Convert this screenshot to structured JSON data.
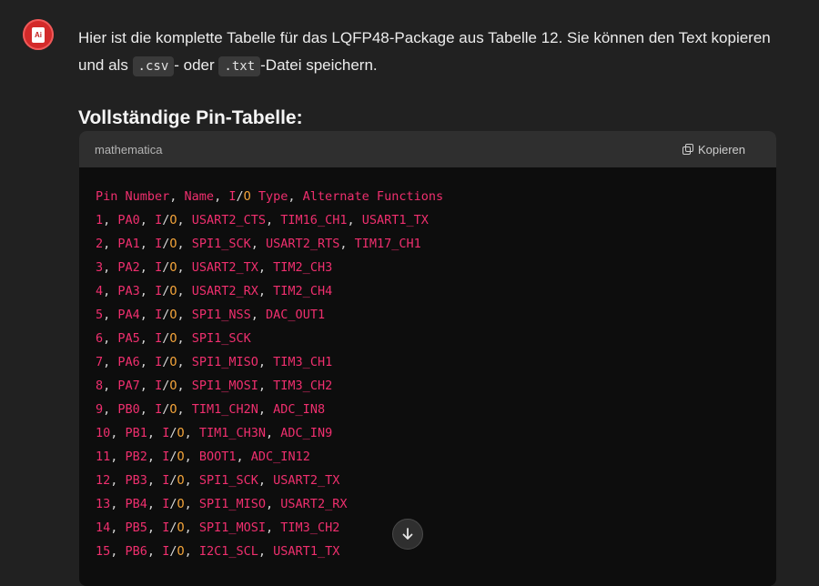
{
  "assistant": {
    "intro_text_1": "Hier ist die komplette Tabelle für das LQFP48-Package aus Tabelle 12. Sie können den Text kopieren und als ",
    "intro_code_csv": ".csv",
    "intro_text_2": "- oder ",
    "intro_code_txt": ".txt",
    "intro_text_3": "-Datei speichern.",
    "section_heading": "Vollständige Pin-Tabelle:",
    "avatar_label": "Ai"
  },
  "codeblock": {
    "language": "mathematica",
    "copy_label": "Kopieren",
    "lines": [
      "Pin Number, Name, I/O Type, Alternate Functions",
      "1, PA0, I/O, USART2_CTS, TIM16_CH1, USART1_TX",
      "2, PA1, I/O, SPI1_SCK, USART2_RTS, TIM17_CH1",
      "3, PA2, I/O, USART2_TX, TIM2_CH3",
      "4, PA3, I/O, USART2_RX, TIM2_CH4",
      "5, PA4, I/O, SPI1_NSS, DAC_OUT1",
      "6, PA5, I/O, SPI1_SCK",
      "7, PA6, I/O, SPI1_MISO, TIM3_CH1",
      "8, PA7, I/O, SPI1_MOSI, TIM3_CH2",
      "9, PB0, I/O, TIM1_CH2N, ADC_IN8",
      "10, PB1, I/O, TIM1_CH3N, ADC_IN9",
      "11, PB2, I/O, BOOT1, ADC_IN12",
      "12, PB3, I/O, SPI1_SCK, USART2_TX",
      "13, PB4, I/O, SPI1_MISO, USART2_RX",
      "14, PB5, I/O, SPI1_MOSI, TIM3_CH2",
      "15, PB6, I/O, I2C1_SCL, USART1_TX"
    ]
  },
  "colors": {
    "string": "#ef2f6e",
    "io": "#f2a33a",
    "punct": "#d8d8d8"
  }
}
